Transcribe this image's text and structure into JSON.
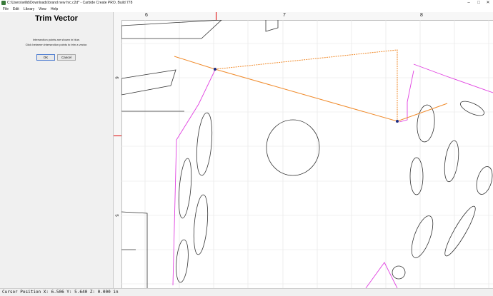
{
  "window": {
    "title": "C:\\Users\\willd\\Downloads\\brand new hrc.c2d* - Carbide Create PRO, Build 778"
  },
  "menu": [
    "File",
    "Edit",
    "Library",
    "View",
    "Help"
  ],
  "panel": {
    "title": "Trim Vector",
    "message_line1": "Intersection points are shown in blue.",
    "message_line2": "Click between intersection points to trim a vector.",
    "ok_label": "OK",
    "cancel_label": "Cancel"
  },
  "rulers": {
    "horizontal_labels": [
      "6",
      "7",
      "8"
    ],
    "vertical_labels": [
      "6",
      "5"
    ]
  },
  "status": {
    "cursor_position": "Cursor Position X: 6.506 Y: 5.640 Z: 0.000 in"
  },
  "colors": {
    "selected_vector": "#f08a2a",
    "guide_vector": "#e040e0",
    "intersection_point": "#1a2a80",
    "outline": "#333333",
    "cursor_marker": "#e00000"
  }
}
